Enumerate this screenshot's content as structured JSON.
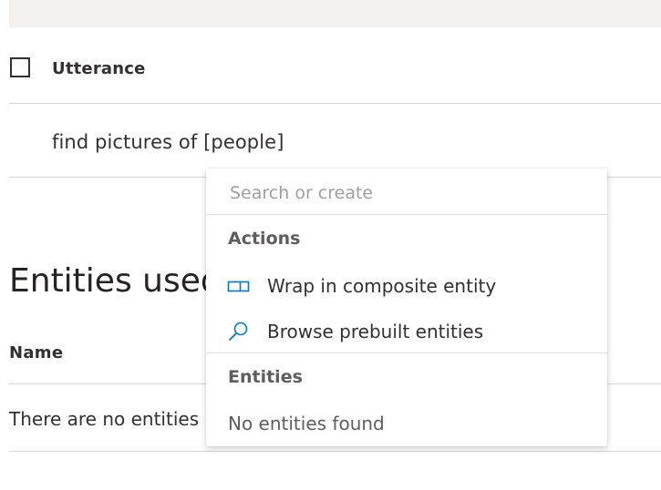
{
  "table": {
    "utterance_header": "Utterance",
    "utterance_text": "find pictures of [people]"
  },
  "entities_section": {
    "title": "Entities used",
    "name_header": "Name",
    "empty_message": "There are no entities"
  },
  "dropdown": {
    "search_placeholder": "Search or create",
    "actions_header": "Actions",
    "actions": [
      {
        "label": "Wrap in composite entity",
        "icon": "composite-entity-icon"
      },
      {
        "label": "Browse prebuilt entities",
        "icon": "search-icon"
      }
    ],
    "entities_header": "Entities",
    "entities_empty": "No entities found"
  },
  "colors": {
    "accent": "#0078d4",
    "top_band": "#f3f2f1",
    "divider": "#d6d6d6"
  }
}
